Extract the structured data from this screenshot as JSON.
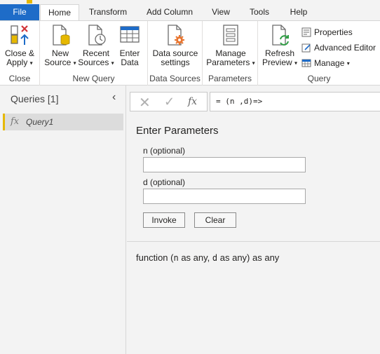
{
  "tabs": {
    "file": "File",
    "home": "Home",
    "transform": "Transform",
    "add_column": "Add Column",
    "view": "View",
    "tools": "Tools",
    "help": "Help"
  },
  "ribbon": {
    "close_group": {
      "label": "Close",
      "close_apply": [
        "Close &",
        "Apply"
      ]
    },
    "new_query_group": {
      "label": "New Query",
      "new_source": [
        "New",
        "Source"
      ],
      "recent_sources": [
        "Recent",
        "Sources"
      ],
      "enter_data": [
        "Enter",
        "Data"
      ]
    },
    "data_sources_group": {
      "label": "Data Sources",
      "settings": [
        "Data source",
        "settings"
      ]
    },
    "parameters_group": {
      "label": "Parameters",
      "manage": [
        "Manage",
        "Parameters"
      ]
    },
    "query_group": {
      "label": "Query",
      "refresh": [
        "Refresh",
        "Preview"
      ],
      "properties": "Properties",
      "advanced_editor": "Advanced Editor",
      "manage": "Manage"
    }
  },
  "queries": {
    "title": "Queries [1]",
    "items": [
      {
        "name": "Query1"
      }
    ]
  },
  "formula_bar": {
    "value": "= (n ,d)=>"
  },
  "params_panel": {
    "title": "Enter Parameters",
    "fields": [
      {
        "label": "n (optional)",
        "value": ""
      },
      {
        "label": "d (optional)",
        "value": ""
      }
    ],
    "invoke_label": "Invoke",
    "clear_label": "Clear",
    "signature": {
      "prefix": "function (",
      "p1": "n",
      "mid1": " as any, ",
      "p2": "d",
      "suffix": " as any) as any"
    }
  },
  "colors": {
    "file_tab": "#1e6cc8",
    "query_accent": "#e6b800",
    "close_x": "#d13438",
    "arrow": "#1e6cc8",
    "gear": "#e8742e"
  }
}
